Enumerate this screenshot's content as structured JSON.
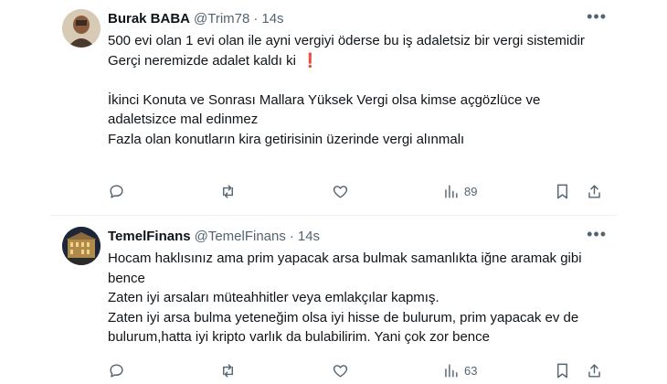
{
  "tweets": [
    {
      "author_name": "Burak BABA",
      "handle": "@Trim78",
      "separator": "·",
      "time": "14s",
      "more_label": "•••",
      "lines": [
        "500 evi olan 1 evi olan ile ayni vergiyi öderse bu iş adaletsiz bir vergi sistemidir",
        "Gerçi neremizde adalet kaldı ki",
        "",
        "İkinci Konuta ve Sonrası Mallara Yüksek Vergi olsa kimse açgözlüce ve adaletsizce mal edinmez",
        "Fazla olan konutların kira getirisinin üzerinde vergi alınmalı"
      ],
      "emoji": "❗",
      "views": "89"
    },
    {
      "author_name": "TemelFinans",
      "handle": "@TemelFinans",
      "separator": "·",
      "time": "14s",
      "more_label": "•••",
      "lines": [
        "Hocam haklısınız ama prim yapacak arsa bulmak samanlıkta iğne aramak gibi bence",
        "Zaten iyi arsaları müteahhitler veya emlakçılar kapmış.",
        "Zaten iyi arsa bulma yeteneğim olsa iyi hisse de bulurum, prim yapacak ev de bulurum,hatta iyi kripto varlık da bulabilirim. Yani çok zor bence"
      ],
      "views": "63"
    }
  ],
  "icons": {
    "reply": "reply-icon",
    "retweet": "retweet-icon",
    "like": "heart-icon",
    "views": "views-chart-icon",
    "bookmark": "bookmark-icon",
    "share": "share-icon"
  },
  "colors": {
    "text": "#0f1419",
    "muted": "#536471",
    "divider": "#eff3f4",
    "emoji": "#e0245e"
  }
}
